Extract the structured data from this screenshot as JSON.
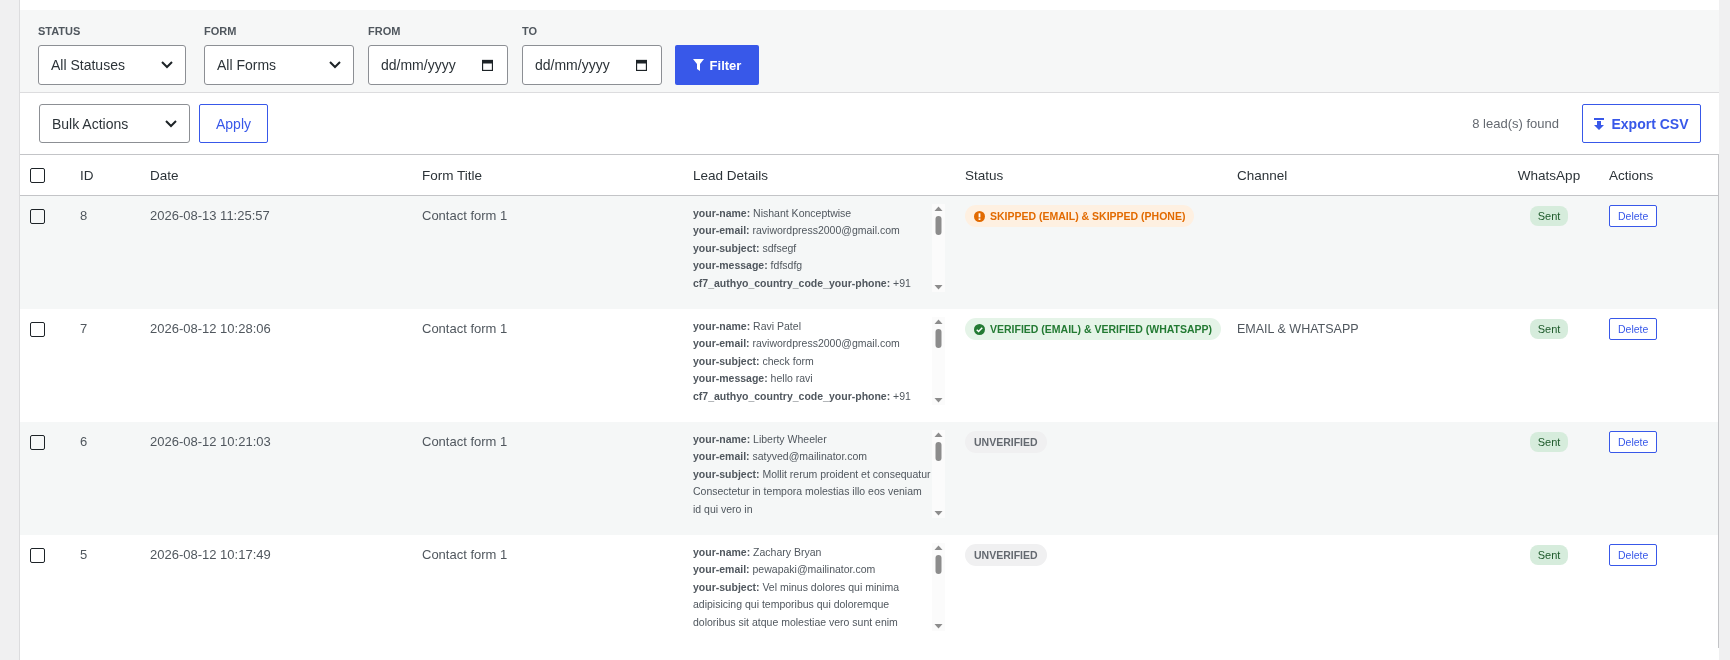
{
  "filters": [
    {
      "label": "STATUS",
      "kind": "select",
      "value": "All Statuses"
    },
    {
      "label": "FORM",
      "kind": "select",
      "value": "All Forms"
    },
    {
      "label": "FROM",
      "kind": "date",
      "placeholder": "dd/mm/yyyy"
    },
    {
      "label": "TO",
      "kind": "date",
      "placeholder": "dd/mm/yyyy"
    }
  ],
  "filter_button": "Filter",
  "toolbar": {
    "bulk_actions": "Bulk Actions",
    "apply": "Apply",
    "count": "8 lead(s) found",
    "export": "Export CSV"
  },
  "table": {
    "select_all": {
      "checked": false
    },
    "columns": [
      "ID",
      "Date",
      "Form Title",
      "Lead Details",
      "Status",
      "Channel",
      "WhatsApp",
      "Actions"
    ],
    "rows": [
      {
        "checked": false,
        "id": "8",
        "date": "2026-08-13 11:25:57",
        "form_title": "Contact form 1",
        "lead_details": [
          "**your-name:** Nishant Konceptwise",
          "**your-email:** raviwordpress2000@gmail.com",
          "**your-subject:** sdfsegf",
          "**your-message:** fdfsdfg",
          "**cf7_authyo_country_code_your-phone:** +91"
        ],
        "status": {
          "kind": "skipped",
          "text": "SKIPPED (EMAIL) & SKIPPED (PHONE)"
        },
        "whatsapp": "Sent",
        "action": "Delete"
      },
      {
        "checked": false,
        "id": "7",
        "date": "2026-08-12 10:28:06",
        "form_title": "Contact form 1",
        "lead_details": [
          "**your-name:** Ravi Patel",
          "**your-email:** raviwordpress2000@gmail.com",
          "**your-subject:** check form",
          "**your-message:** hello ravi",
          "**cf7_authyo_country_code_your-phone:** +91"
        ],
        "status": {
          "kind": "verified",
          "text": "VERIFIED (EMAIL) & VERIFIED (WHATSAPP)"
        },
        "channel": "EMAIL & WHATSAPP",
        "whatsapp": "Sent",
        "action": "Delete"
      },
      {
        "checked": false,
        "id": "6",
        "date": "2026-08-12 10:21:03",
        "form_title": "Contact form 1",
        "lead_details": [
          "**your-name:** Liberty Wheeler",
          "**your-email:** satyved@mailinator.com",
          "**your-subject:** Mollit rerum proident et consequatur Consectetur in tempora molestias illo eos veniam id qui vero in"
        ],
        "status": {
          "kind": "unverified",
          "text": "UNVERIFIED"
        },
        "whatsapp": "Sent",
        "action": "Delete"
      },
      {
        "checked": false,
        "id": "5",
        "date": "2026-08-12 10:17:49",
        "form_title": "Contact form 1",
        "lead_details": [
          "**your-name:** Zachary Bryan",
          "**your-email:** pewapaki@mailinator.com",
          "**your-subject:** Vel minus dolores qui minima adipisicing qui temporibus qui doloremque doloribus sit atque molestiae vero sunt enim"
        ],
        "status": {
          "kind": "unverified",
          "text": "UNVERIFIED"
        },
        "whatsapp": "Sent",
        "action": "Delete"
      }
    ]
  }
}
